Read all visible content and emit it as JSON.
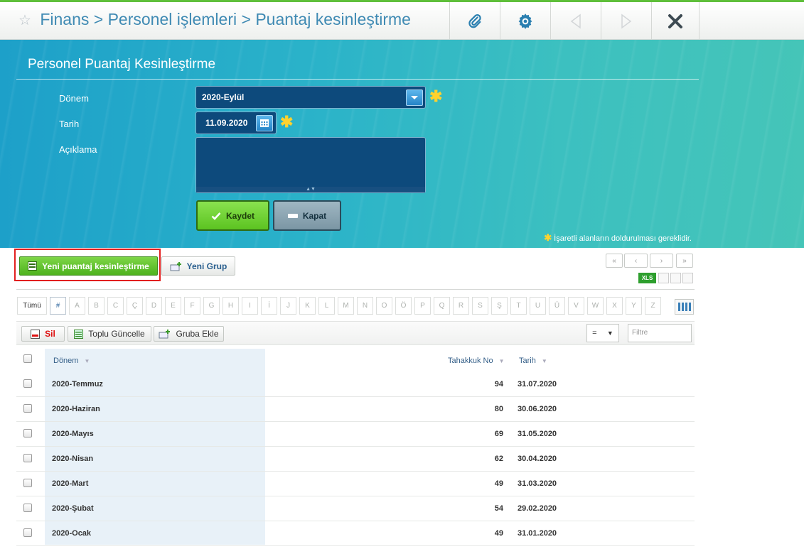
{
  "header": {
    "breadcrumb": [
      "Finans",
      "Personel işlemleri",
      "Puantaj kesinleştirme"
    ],
    "separator": ">"
  },
  "form": {
    "title": "Personel Puantaj Kesinleştirme",
    "donem_label": "Dönem",
    "donem_value": "2020-Eylül",
    "tarih_label": "Tarih",
    "tarih_value": "11.09.2020",
    "aciklama_label": "Açıklama",
    "aciklama_value": "",
    "save_label": "Kaydet",
    "close_label": "Kapat",
    "required_note": "İşaretli alanların doldurulması gereklidir."
  },
  "toolbar": {
    "new_label": "Yeni puantaj kesinleştirme",
    "new_group_label": "Yeni Grup",
    "pager": [
      "«",
      "‹",
      "›",
      "»"
    ],
    "xls_label": "XLS"
  },
  "letters": [
    "Tümü",
    "#",
    "A",
    "B",
    "C",
    "Ç",
    "D",
    "E",
    "F",
    "G",
    "H",
    "I",
    "İ",
    "J",
    "K",
    "L",
    "M",
    "N",
    "O",
    "Ö",
    "P",
    "Q",
    "R",
    "S",
    "Ş",
    "T",
    "U",
    "Ü",
    "V",
    "W",
    "X",
    "Y",
    "Z"
  ],
  "actions": {
    "delete_label": "Sil",
    "bulk_update_label": "Toplu Güncelle",
    "add_group_label": "Gruba Ekle",
    "filter_operator": "=",
    "filter_placeholder": "Filtre"
  },
  "table": {
    "columns": [
      "Dönem",
      "Tahakkuk No",
      "Tarih"
    ],
    "rows": [
      {
        "donem": "2020-Temmuz",
        "no": "94",
        "tarih": "31.07.2020"
      },
      {
        "donem": "2020-Haziran",
        "no": "80",
        "tarih": "30.06.2020"
      },
      {
        "donem": "2020-Mayıs",
        "no": "69",
        "tarih": "31.05.2020"
      },
      {
        "donem": "2020-Nisan",
        "no": "62",
        "tarih": "30.04.2020"
      },
      {
        "donem": "2020-Mart",
        "no": "49",
        "tarih": "31.03.2020"
      },
      {
        "donem": "2020-Şubat",
        "no": "54",
        "tarih": "29.02.2020"
      },
      {
        "donem": "2020-Ocak",
        "no": "49",
        "tarih": "31.01.2020"
      }
    ]
  },
  "colors": {
    "accent": "#3f8ab3",
    "save_green": "#5cc321",
    "highlight_red": "#e21f1f",
    "required_yellow": "#ffd22e"
  }
}
